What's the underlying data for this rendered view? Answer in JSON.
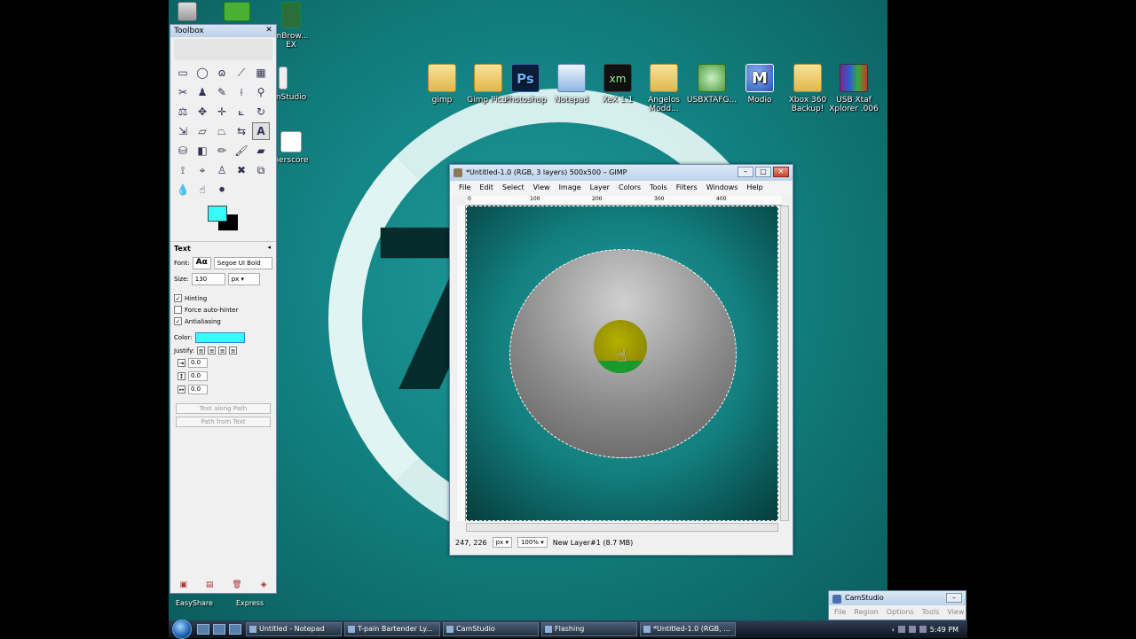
{
  "desktop": {
    "icons": [
      {
        "label": "gimp",
        "kind": "folder"
      },
      {
        "label": "Gimp Pics!",
        "kind": "folder"
      },
      {
        "label": "Photoshop",
        "kind": "ps",
        "glyph": "Ps"
      },
      {
        "label": "Notepad",
        "kind": "np"
      },
      {
        "label": "XeX 1.1",
        "kind": "xm",
        "glyph": "xm"
      },
      {
        "label": "Angelos Modd...",
        "kind": "folder"
      },
      {
        "label": "USBXTAFG...",
        "kind": "xbox"
      },
      {
        "label": "Modio",
        "kind": "modio",
        "glyph": "M"
      },
      {
        "label": "Xbox 360 Backup!",
        "kind": "folder"
      },
      {
        "label": "USB Xtaf Xplorer .006",
        "kind": "rar"
      }
    ],
    "left_labels": [
      "mBrow... EX",
      "nStudio",
      "nerscore"
    ],
    "bottom_labels": [
      "EasyShare",
      "Express"
    ],
    "sidebar_control": [
      "+",
      "‹",
      "›"
    ]
  },
  "toolbox": {
    "title": "Toolbox",
    "text_options": {
      "section_title": "Text",
      "font_label": "Font:",
      "font_glyph": "Aα",
      "font_value": "Segoe UI Bold",
      "size_label": "Size:",
      "size_value": "130",
      "size_unit": "px",
      "hinting": "Hinting",
      "force_autohinter": "Force auto-hinter",
      "antialiasing": "Antialiasing",
      "color_label": "Color:",
      "justify_label": "Justify:",
      "indent_value": "0.0",
      "line_spacing_value": "0.0",
      "letter_spacing_value": "0.0",
      "text_along_path": "Text along Path",
      "path_from_text": "Path from Text"
    },
    "colors": {
      "fg": "#33ffff",
      "bg": "#000000"
    }
  },
  "gimp_window": {
    "title": "*Untitled-1.0 (RGB, 3 layers) 500x500 – GIMP",
    "menu": [
      "File",
      "Edit",
      "Select",
      "View",
      "Image",
      "Layer",
      "Colors",
      "Tools",
      "Filters",
      "Windows",
      "Help"
    ],
    "ruler_top": [
      "0",
      "100",
      "200",
      "300",
      "400"
    ],
    "status": {
      "coords": "247, 226",
      "unit": "px",
      "zoom": "100%",
      "layer_info": "New Layer#1 (8.7 MB)"
    }
  },
  "camstudio": {
    "title": "CamStudio",
    "menu": [
      "File",
      "Region",
      "Options",
      "Tools",
      "View"
    ]
  },
  "taskbar": {
    "buttons": [
      "Untitled - Notepad",
      "T-pain Bartender Ly...",
      "CamStudio",
      "Flashing",
      "*Untitled-1.0 (RGB, ..."
    ],
    "clock": "5:49 PM"
  }
}
